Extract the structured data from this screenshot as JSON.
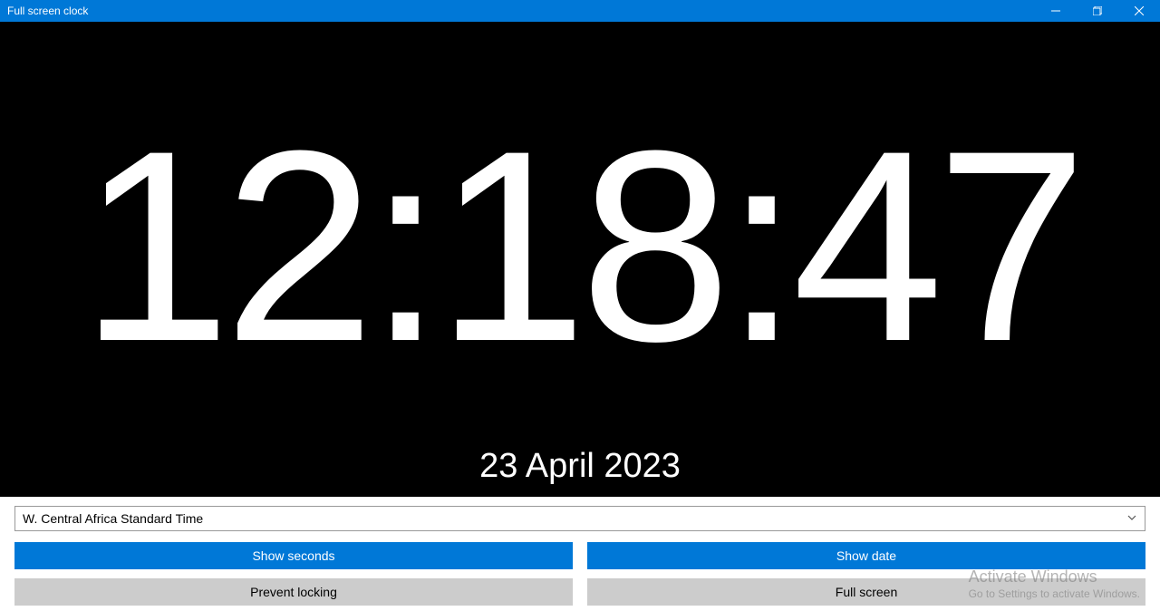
{
  "window": {
    "title": "Full screen clock"
  },
  "clock": {
    "time": "12:18:47",
    "date": "23 April 2023"
  },
  "timezone": {
    "selected": "W. Central Africa Standard Time"
  },
  "buttons": {
    "show_seconds": "Show seconds",
    "show_date": "Show date",
    "prevent_locking": "Prevent locking",
    "full_screen": "Full screen"
  },
  "watermark": {
    "title": "Activate Windows",
    "subtitle": "Go to Settings to activate Windows."
  }
}
